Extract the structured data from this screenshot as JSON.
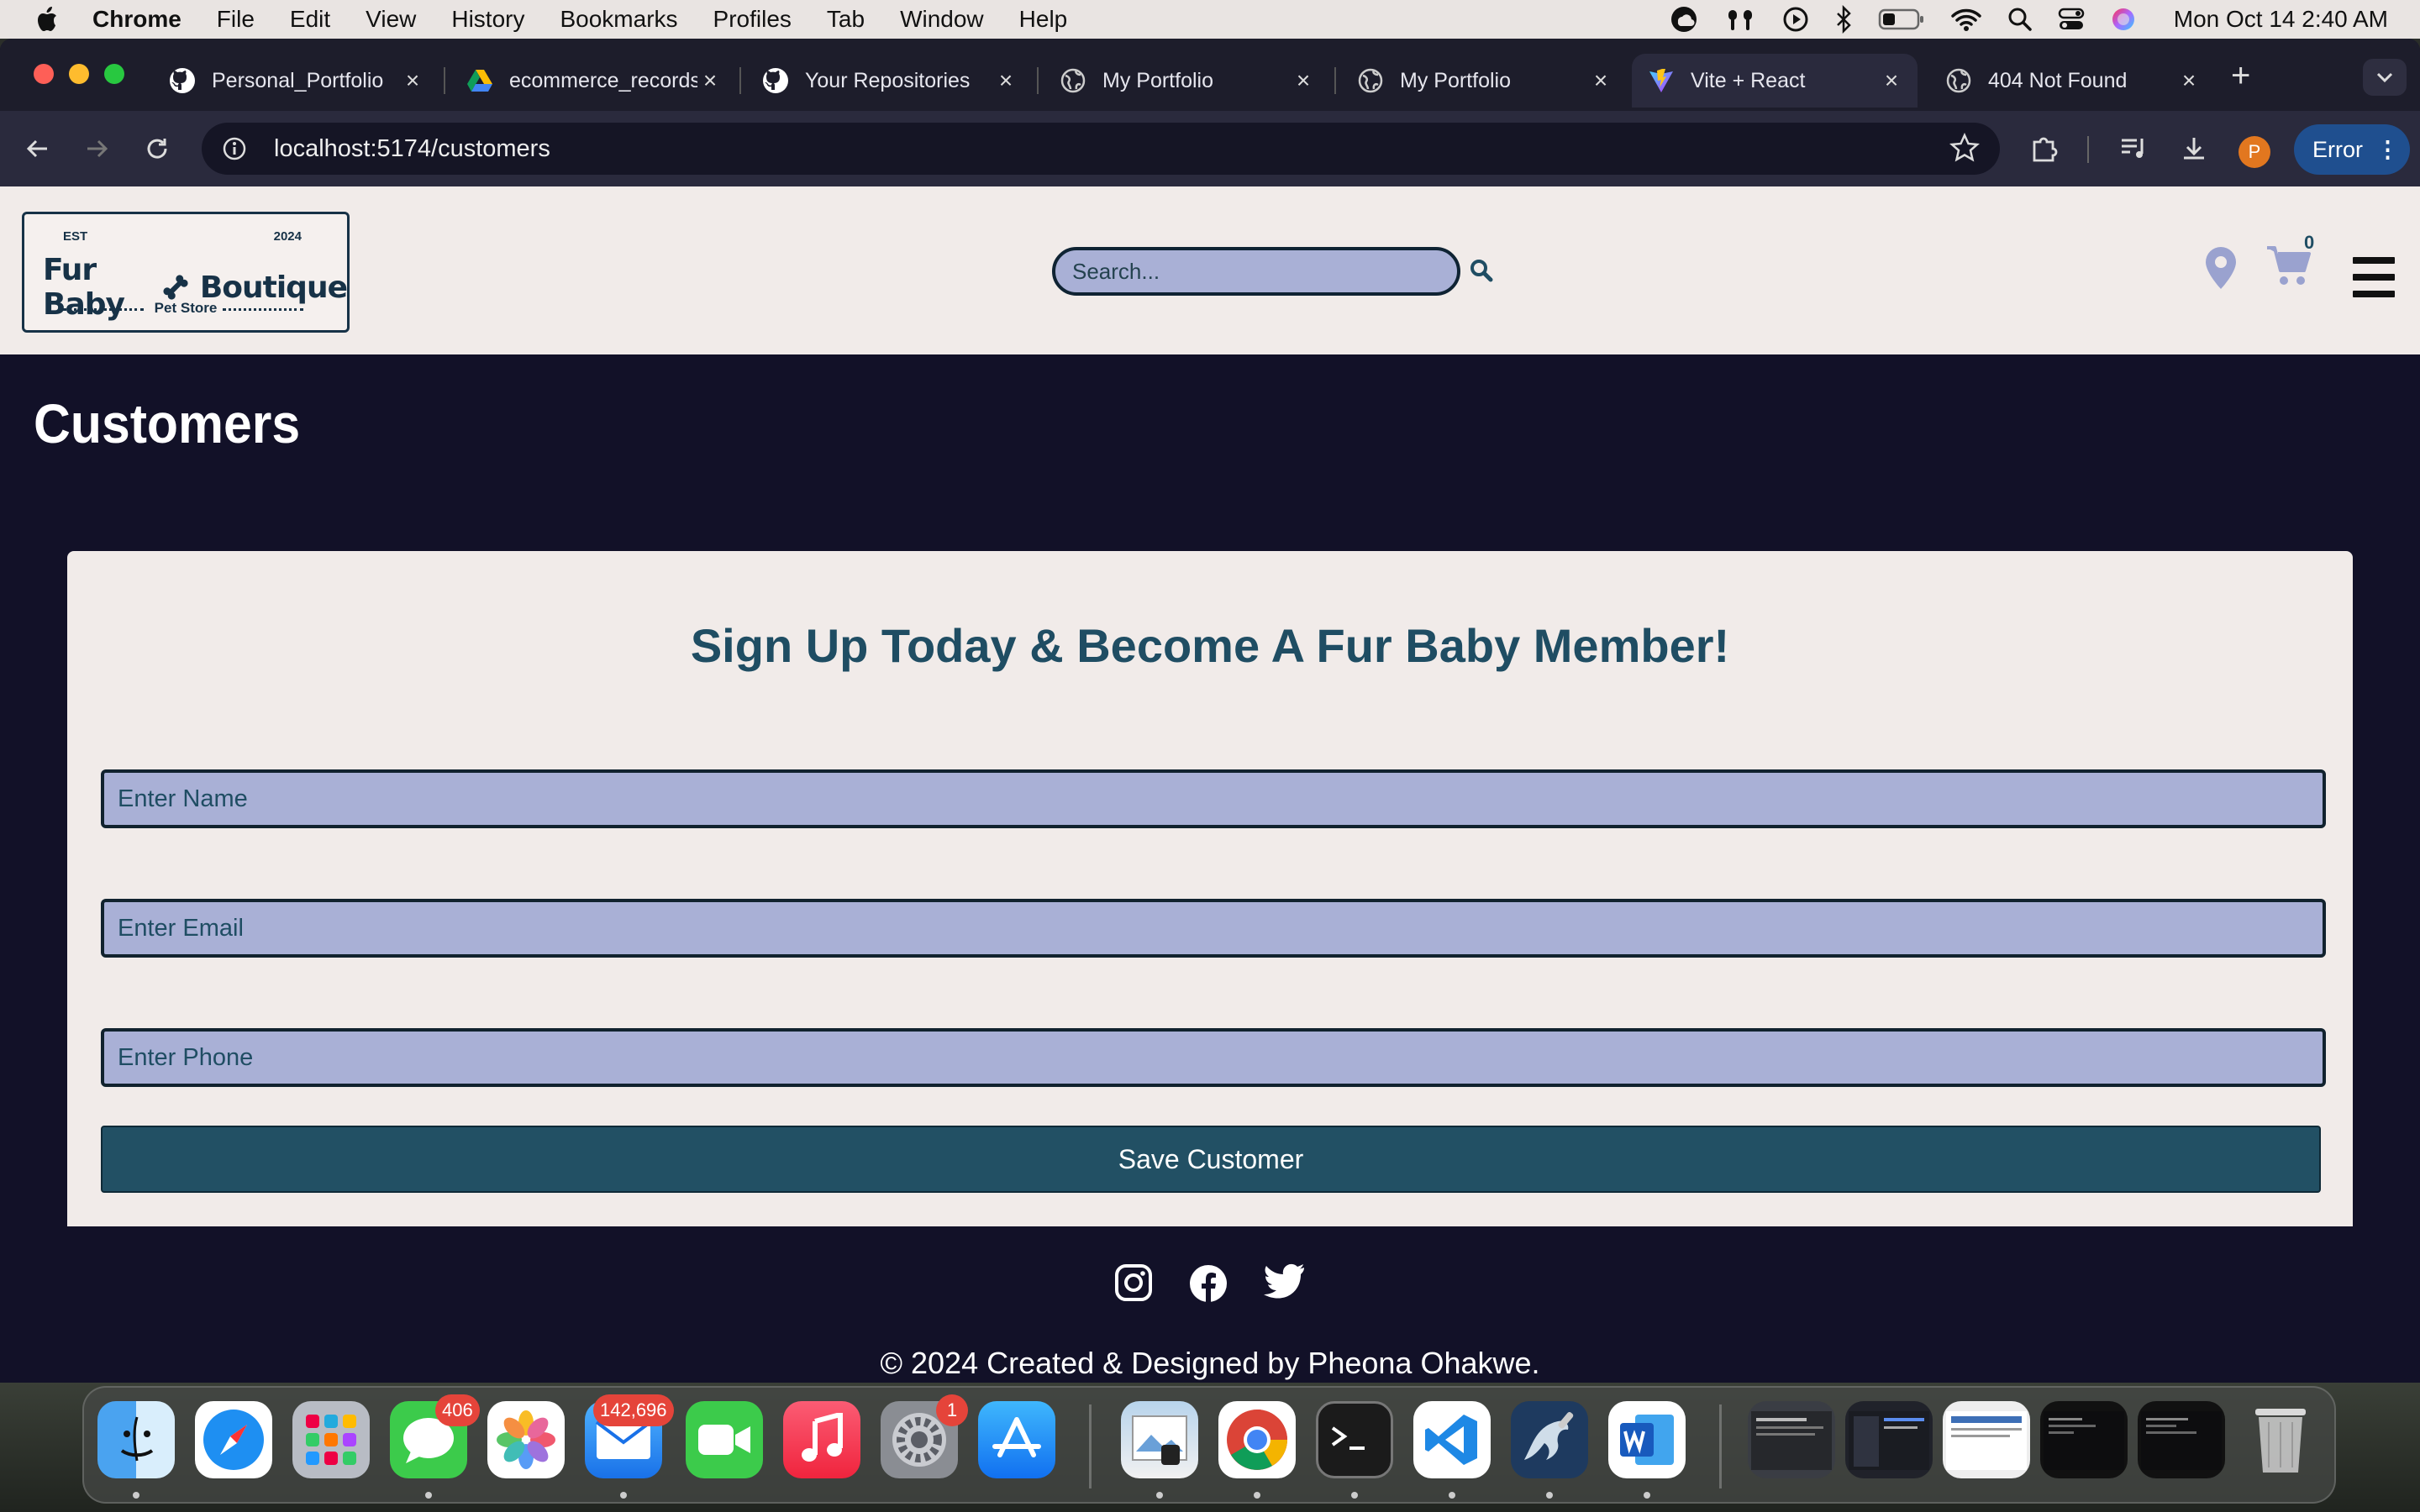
{
  "menubar": {
    "app_name": "Chrome",
    "items": [
      "File",
      "Edit",
      "View",
      "History",
      "Bookmarks",
      "Profiles",
      "Tab",
      "Window",
      "Help"
    ],
    "clock": "Mon Oct 14  2:40 AM"
  },
  "tabs": [
    {
      "title": "Personal_Portfolio",
      "icon": "github-icon"
    },
    {
      "title": "ecommerce_records",
      "icon": "google-drive-icon"
    },
    {
      "title": "Your Repositories",
      "icon": "github-icon"
    },
    {
      "title": "My Portfolio",
      "icon": "globe-icon"
    },
    {
      "title": "My Portfolio",
      "icon": "globe-icon"
    },
    {
      "title": "Vite + React",
      "icon": "vite-icon",
      "active": true
    },
    {
      "title": "404 Not Found",
      "icon": "globe-icon"
    }
  ],
  "toolbar": {
    "url": "localhost:5174/customers",
    "profile_initial": "P",
    "error_label": "Error"
  },
  "site": {
    "logo": {
      "est": "EST",
      "year": "2024",
      "name_left": "Fur Baby",
      "name_right": "Boutique",
      "subtitle": "Pet Store"
    },
    "search_placeholder": "Search...",
    "cart_count": "0",
    "page_title": "Customers",
    "form": {
      "heading": "Sign Up Today & Become A Fur Baby Member!",
      "name_placeholder": "Enter Name",
      "email_placeholder": "Enter Email",
      "phone_placeholder": "Enter Phone",
      "save_label": "Save Customer"
    },
    "footer": "© 2024 Created & Designed by Pheona Ohakwe."
  },
  "dock": {
    "messages_badge": "406",
    "mail_badge": "142,696",
    "settings_badge": "1"
  },
  "colors": {
    "brand_dark": "#121128",
    "brand_teal": "#1f4d63",
    "input_fill": "#a9b0d6",
    "header_bg": "#f1ebe9"
  }
}
